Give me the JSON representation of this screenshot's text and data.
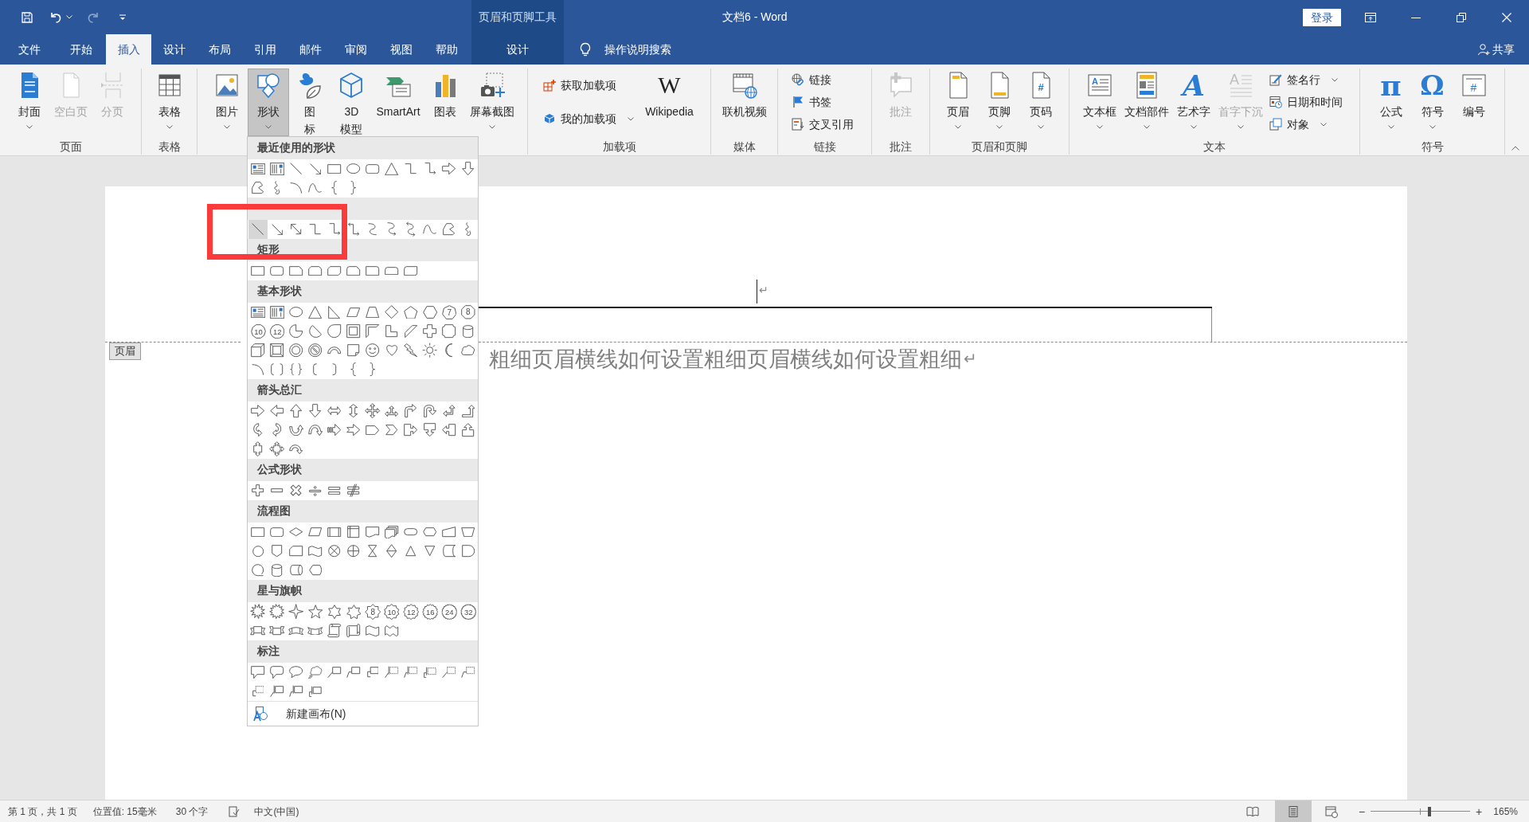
{
  "window": {
    "title": "文档6 - Word",
    "sign_in": "登录",
    "controls": [
      {
        "kind": "ribbon-options"
      },
      {
        "kind": "minimize"
      },
      {
        "kind": "restore"
      },
      {
        "kind": "close"
      }
    ]
  },
  "quick_access": [
    {
      "kind": "save",
      "disabled": false
    },
    {
      "kind": "undo",
      "disabled": false
    },
    {
      "kind": "undo-menu",
      "disabled": false
    },
    {
      "kind": "redo",
      "disabled": true
    },
    {
      "kind": "customize",
      "disabled": false
    }
  ],
  "tabs": [
    {
      "label": "文件",
      "selected": false
    },
    {
      "label": "开始",
      "selected": false
    },
    {
      "label": "插入",
      "selected": true
    },
    {
      "label": "设计",
      "selected": false
    },
    {
      "label": "布局",
      "selected": false
    },
    {
      "label": "引用",
      "selected": false
    },
    {
      "label": "邮件",
      "selected": false
    },
    {
      "label": "审阅",
      "selected": false
    },
    {
      "label": "视图",
      "selected": false
    },
    {
      "label": "帮助",
      "selected": false
    }
  ],
  "context_tabs": {
    "title": "页眉和页脚工具",
    "tabs": [
      {
        "label": "设计",
        "selected": false
      }
    ]
  },
  "tell_me": {
    "label": "操作说明搜索"
  },
  "share": {
    "label": "共享"
  },
  "ribbon": {
    "groups": [
      {
        "label": "页面",
        "items": [
          {
            "kind": "cover",
            "label": "封面",
            "dropdown": true,
            "disabled": false,
            "pressed": false
          },
          {
            "kind": "blank-page",
            "label": "空白页",
            "dropdown": false,
            "disabled": true,
            "pressed": false
          },
          {
            "kind": "page-break",
            "label": "分页",
            "dropdown": false,
            "disabled": true,
            "pressed": false
          }
        ]
      },
      {
        "label": "表格",
        "items": [
          {
            "kind": "table",
            "label": "表格",
            "dropdown": true,
            "disabled": false,
            "pressed": false
          }
        ]
      },
      {
        "items": [
          {
            "kind": "picture",
            "label": "图片",
            "dropdown": true,
            "disabled": false,
            "pressed": false
          },
          {
            "kind": "shapes",
            "label": "形状",
            "dropdown": true,
            "disabled": false,
            "pressed": true
          },
          {
            "kind": "icons",
            "lines": [
              "图",
              "标"
            ],
            "dropdown": false,
            "disabled": false,
            "pressed": false
          },
          {
            "kind": "model3d",
            "lines": [
              "3D",
              "模型"
            ],
            "dropdown": false,
            "disabled": false,
            "pressed": false
          },
          {
            "kind": "smartart",
            "label": "SmartArt",
            "dropdown": false,
            "disabled": false,
            "pressed": false
          },
          {
            "kind": "chart",
            "label": "图表",
            "dropdown": false,
            "disabled": false,
            "pressed": false
          },
          {
            "kind": "screenshot",
            "label": "屏幕截图",
            "dropdown": true,
            "disabled": false,
            "pressed": false
          }
        ]
      },
      {
        "label": "加载项",
        "items": [
          {
            "stack": [
              {
                "kind": "get-addins",
                "label": "获取加载项",
                "dropdown": false,
                "disabled": false
              },
              {
                "kind": "my-addins",
                "label": "我的加载项",
                "dropdown": true,
                "disabled": false
              }
            ]
          },
          {
            "kind": "wikipedia",
            "label": "Wikipedia",
            "glyph": "W",
            "dropdown": false,
            "disabled": false,
            "pressed": false
          }
        ]
      },
      {
        "label": "媒体",
        "items": [
          {
            "kind": "online-video",
            "label": "联机视频",
            "dropdown": false,
            "disabled": false,
            "pressed": false
          }
        ]
      },
      {
        "label": "链接",
        "items": [
          {
            "stack": [
              {
                "kind": "link",
                "label": "链接",
                "dropdown": false,
                "disabled": false
              },
              {
                "kind": "bookmark",
                "label": "书签",
                "dropdown": false,
                "disabled": false
              },
              {
                "kind": "cross-reference",
                "label": "交叉引用",
                "dropdown": false,
                "disabled": false
              }
            ]
          }
        ]
      },
      {
        "label": "批注",
        "items": [
          {
            "kind": "comment",
            "label": "批注",
            "dropdown": false,
            "disabled": true,
            "pressed": false
          }
        ]
      },
      {
        "label": "页眉和页脚",
        "items": [
          {
            "kind": "header",
            "label": "页眉",
            "dropdown": true,
            "disabled": false,
            "pressed": false
          },
          {
            "kind": "footer",
            "label": "页脚",
            "dropdown": true,
            "disabled": false,
            "pressed": false
          },
          {
            "kind": "page-number",
            "label": "页码",
            "glyph": "#",
            "dropdown": true,
            "disabled": false,
            "pressed": false
          }
        ]
      },
      {
        "label": "文本",
        "items": [
          {
            "kind": "textbox",
            "label": "文本框",
            "glyph": "A",
            "dropdown": true,
            "disabled": false,
            "pressed": false
          },
          {
            "kind": "doc-parts",
            "label": "文档部件",
            "dropdown": true,
            "disabled": false,
            "pressed": false
          },
          {
            "kind": "wordart",
            "label": "艺术字",
            "glyph": "A",
            "dropdown": true,
            "disabled": false,
            "pressed": false
          },
          {
            "kind": "drop-cap",
            "label": "首字下沉",
            "glyph": "A",
            "dropdown": true,
            "disabled": true,
            "pressed": false
          },
          {
            "stack": [
              {
                "kind": "signature",
                "label": "签名行",
                "dropdown": true,
                "disabled": false
              },
              {
                "kind": "date-time",
                "label": "日期和时间",
                "dropdown": false,
                "disabled": false
              },
              {
                "kind": "object",
                "label": "对象",
                "dropdown": true,
                "disabled": false
              }
            ]
          }
        ]
      },
      {
        "label": "符号",
        "items": [
          {
            "kind": "equation",
            "label": "公式",
            "glyph": "π",
            "dropdown": true,
            "disabled": false,
            "pressed": false
          },
          {
            "kind": "symbol",
            "label": "符号",
            "glyph": "Ω",
            "dropdown": true,
            "disabled": false,
            "pressed": false
          },
          {
            "kind": "numbering",
            "label": "编号",
            "glyph": "#",
            "dropdown": false,
            "disabled": false,
            "pressed": false
          }
        ]
      }
    ]
  },
  "shapes_menu": {
    "sections": [
      {
        "title": "最近使用的形状",
        "shapes": [
          {
            "kind": "textbox",
            "selected": false
          },
          {
            "kind": "vtextbox",
            "selected": false
          },
          {
            "kind": "line",
            "selected": false
          },
          {
            "kind": "arrow",
            "selected": false
          },
          {
            "kind": "rect",
            "selected": false
          },
          {
            "kind": "oval",
            "selected": false
          },
          {
            "kind": "rrect",
            "selected": false
          },
          {
            "kind": "triangle",
            "selected": false
          },
          {
            "kind": "elbow",
            "selected": false
          },
          {
            "kind": "elbowarrow",
            "selected": false
          },
          {
            "kind": "rightarrow",
            "selected": false
          },
          {
            "kind": "downarrow",
            "selected": false
          },
          {
            "kind": "freeform",
            "selected": false
          },
          {
            "kind": "scribble",
            "selected": false
          },
          {
            "kind": "arc",
            "selected": false
          },
          {
            "kind": "curve",
            "selected": false
          },
          {
            "kind": "lbrace",
            "selected": false
          },
          {
            "kind": "rbrace",
            "selected": false
          }
        ]
      },
      {
        "shapes": [
          {
            "kind": "line",
            "selected": true
          },
          {
            "kind": "arrow",
            "selected": false
          },
          {
            "kind": "darrowline",
            "selected": false
          },
          {
            "kind": "elbow",
            "selected": false
          },
          {
            "kind": "elbowarrow",
            "selected": false
          },
          {
            "kind": "elbowdarrow",
            "selected": false
          },
          {
            "kind": "curvedconn",
            "selected": false
          },
          {
            "kind": "curvedarrow",
            "selected": false
          },
          {
            "kind": "curveddarrow",
            "selected": false
          },
          {
            "kind": "curve",
            "selected": false
          },
          {
            "kind": "freeform",
            "selected": false
          },
          {
            "kind": "scribble",
            "selected": false
          }
        ]
      },
      {
        "title": "矩形",
        "shapes": [
          {
            "kind": "rect",
            "selected": false
          },
          {
            "kind": "rrect",
            "selected": false
          },
          {
            "kind": "snip1",
            "selected": false
          },
          {
            "kind": "snip2same",
            "selected": false
          },
          {
            "kind": "snip2diag",
            "selected": false
          },
          {
            "kind": "snipround",
            "selected": false
          },
          {
            "kind": "round1",
            "selected": false
          },
          {
            "kind": "round2same",
            "selected": false
          },
          {
            "kind": "round2diag",
            "selected": false
          }
        ]
      },
      {
        "title": "基本形状",
        "shapes": [
          {
            "kind": "textbox",
            "selected": false
          },
          {
            "kind": "vtextbox",
            "selected": false
          },
          {
            "kind": "oval",
            "selected": false
          },
          {
            "kind": "triangle",
            "selected": false
          },
          {
            "kind": "rtriangle",
            "selected": false
          },
          {
            "kind": "parallelogram",
            "selected": false
          },
          {
            "kind": "trapezoid",
            "selected": false
          },
          {
            "kind": "diamond",
            "selected": false
          },
          {
            "kind": "pentagon",
            "selected": false
          },
          {
            "kind": "hexagon",
            "selected": false
          },
          {
            "kind": "heptagon",
            "label": "7",
            "selected": false
          },
          {
            "kind": "octagon",
            "label": "8",
            "selected": false
          },
          {
            "kind": "decagon",
            "label": "10",
            "selected": false
          },
          {
            "kind": "dodecagon",
            "label": "12",
            "selected": false
          },
          {
            "kind": "pie",
            "selected": false
          },
          {
            "kind": "chord",
            "selected": false
          },
          {
            "kind": "teardrop",
            "selected": false
          },
          {
            "kind": "frame",
            "selected": false
          },
          {
            "kind": "halfframe",
            "selected": false
          },
          {
            "kind": "lshape",
            "selected": false
          },
          {
            "kind": "diagstripe",
            "selected": false
          },
          {
            "kind": "cross",
            "selected": false
          },
          {
            "kind": "plaque",
            "selected": false
          },
          {
            "kind": "can",
            "selected": false
          },
          {
            "kind": "cube",
            "selected": false
          },
          {
            "kind": "bevel",
            "selected": false
          },
          {
            "kind": "donut",
            "selected": false
          },
          {
            "kind": "nosymbol",
            "selected": false
          },
          {
            "kind": "blockarc",
            "selected": false
          },
          {
            "kind": "folded",
            "selected": false
          },
          {
            "kind": "smiley",
            "selected": false
          },
          {
            "kind": "heart",
            "selected": false
          },
          {
            "kind": "lightning",
            "selected": false
          },
          {
            "kind": "sun",
            "selected": false
          },
          {
            "kind": "moon",
            "selected": false
          },
          {
            "kind": "cloud",
            "selected": false
          },
          {
            "kind": "arc",
            "selected": false
          },
          {
            "kind": "dbracket",
            "selected": false
          },
          {
            "kind": "dbrace",
            "selected": false
          },
          {
            "kind": "lbracket",
            "selected": false
          },
          {
            "kind": "rbracket",
            "selected": false
          },
          {
            "kind": "lbrace",
            "selected": false
          },
          {
            "kind": "rbrace",
            "selected": false
          }
        ]
      },
      {
        "title": "箭头总汇",
        "shapes": [
          {
            "kind": "rightarrow",
            "selected": false
          },
          {
            "kind": "leftarrow",
            "selected": false
          },
          {
            "kind": "uparrow",
            "selected": false
          },
          {
            "kind": "downarrow",
            "selected": false
          },
          {
            "kind": "leftright",
            "selected": false
          },
          {
            "kind": "updown",
            "selected": false
          },
          {
            "kind": "quad",
            "selected": false
          },
          {
            "kind": "leftrightup",
            "selected": false
          },
          {
            "kind": "bent",
            "selected": false
          },
          {
            "kind": "uturn",
            "selected": false
          },
          {
            "kind": "leftup",
            "selected": false
          },
          {
            "kind": "bentup",
            "selected": false
          },
          {
            "kind": "curvedright",
            "selected": false
          },
          {
            "kind": "curvedleft",
            "selected": false
          },
          {
            "kind": "curvedup",
            "selected": false
          },
          {
            "kind": "curveddown",
            "selected": false
          },
          {
            "kind": "striped",
            "selected": false
          },
          {
            "kind": "notched",
            "selected": false
          },
          {
            "kind": "homeplate",
            "selected": false
          },
          {
            "kind": "chevron",
            "selected": false
          },
          {
            "kind": "rightcallout",
            "selected": false
          },
          {
            "kind": "downcallout",
            "selected": false
          },
          {
            "kind": "leftcallout",
            "selected": false
          },
          {
            "kind": "upcallout",
            "selected": false
          },
          {
            "kind": "udcallout",
            "selected": false
          },
          {
            "kind": "quadcallout",
            "selected": false
          },
          {
            "kind": "circular",
            "selected": false
          }
        ]
      },
      {
        "title": "公式形状",
        "shapes": [
          {
            "kind": "plus",
            "selected": false
          },
          {
            "kind": "minus",
            "selected": false
          },
          {
            "kind": "multiply",
            "selected": false
          },
          {
            "kind": "divide",
            "selected": false
          },
          {
            "kind": "equal",
            "selected": false
          },
          {
            "kind": "notequal",
            "selected": false
          }
        ]
      },
      {
        "title": "流程图",
        "shapes": [
          {
            "kind": "rect",
            "selected": false
          },
          {
            "kind": "rrect",
            "selected": false
          },
          {
            "kind": "decision",
            "selected": false
          },
          {
            "kind": "data",
            "selected": false
          },
          {
            "kind": "predefined",
            "selected": false
          },
          {
            "kind": "internal",
            "selected": false
          },
          {
            "kind": "document",
            "selected": false
          },
          {
            "kind": "multidoc",
            "selected": false
          },
          {
            "kind": "terminator",
            "selected": false
          },
          {
            "kind": "preparation",
            "selected": false
          },
          {
            "kind": "manualinput",
            "selected": false
          },
          {
            "kind": "manualop",
            "selected": false
          },
          {
            "kind": "connector",
            "selected": false
          },
          {
            "kind": "offpage",
            "selected": false
          },
          {
            "kind": "card",
            "selected": false
          },
          {
            "kind": "wave",
            "selected": false
          },
          {
            "kind": "summing",
            "selected": false
          },
          {
            "kind": "orjunction",
            "selected": false
          },
          {
            "kind": "collate",
            "selected": false
          },
          {
            "kind": "sort",
            "selected": false
          },
          {
            "kind": "extract",
            "selected": false
          },
          {
            "kind": "merge",
            "selected": false
          },
          {
            "kind": "storeddata",
            "selected": false
          },
          {
            "kind": "delay",
            "selected": false
          },
          {
            "kind": "seqaccess",
            "selected": false
          },
          {
            "kind": "can",
            "selected": false
          },
          {
            "kind": "directaccess",
            "selected": false
          },
          {
            "kind": "display",
            "selected": false
          }
        ]
      },
      {
        "title": "星与旗帜",
        "shapes": [
          {
            "kind": "explosion1",
            "selected": false
          },
          {
            "kind": "explosion2",
            "selected": false
          },
          {
            "kind": "star4",
            "selected": false
          },
          {
            "kind": "star5",
            "selected": false
          },
          {
            "kind": "star6",
            "selected": false
          },
          {
            "kind": "star7",
            "selected": false
          },
          {
            "kind": "star8",
            "label": "8",
            "selected": false
          },
          {
            "kind": "star10",
            "label": "10",
            "selected": false
          },
          {
            "kind": "star12",
            "label": "12",
            "selected": false
          },
          {
            "kind": "star16",
            "label": "16",
            "selected": false
          },
          {
            "kind": "star24",
            "label": "24",
            "selected": false
          },
          {
            "kind": "star32",
            "label": "32",
            "selected": false
          },
          {
            "kind": "ribbondown",
            "selected": false
          },
          {
            "kind": "ribbonup",
            "selected": false
          },
          {
            "kind": "curvedribbondown",
            "selected": false
          },
          {
            "kind": "curvedribbonup",
            "selected": false
          },
          {
            "kind": "vscroll",
            "selected": false
          },
          {
            "kind": "hscroll",
            "selected": false
          },
          {
            "kind": "wave",
            "selected": false
          },
          {
            "kind": "doublewave",
            "selected": false
          }
        ]
      },
      {
        "title": "标注",
        "shapes": [
          {
            "kind": "calloutrect",
            "selected": false
          },
          {
            "kind": "calloutrrect",
            "selected": false
          },
          {
            "kind": "calloutoval",
            "selected": false
          },
          {
            "kind": "calloutcloud",
            "selected": false
          },
          {
            "kind": "lc1",
            "selected": false
          },
          {
            "kind": "lc2",
            "selected": false
          },
          {
            "kind": "lc3",
            "selected": false
          },
          {
            "kind": "ac1",
            "selected": false
          },
          {
            "kind": "ac2",
            "selected": false
          },
          {
            "kind": "ac3",
            "selected": false
          },
          {
            "kind": "nb1",
            "selected": false
          },
          {
            "kind": "nb2",
            "selected": false
          },
          {
            "kind": "nb3",
            "selected": false
          },
          {
            "kind": "ab1",
            "selected": false
          },
          {
            "kind": "ab2",
            "selected": false
          },
          {
            "kind": "ab3",
            "selected": false
          }
        ]
      }
    ],
    "new_canvas": "新建画布(N)"
  },
  "document": {
    "header_tag": "页眉",
    "header_paragraph_mark": "↵",
    "body": {
      "text": "粗细页眉横线如何设置粗细页眉横线如何设置粗细",
      "paragraph_mark": "↵"
    }
  },
  "annotations": [
    {
      "kind": "frame"
    }
  ],
  "status_bar": {
    "page": "第 1 页，共 1 页",
    "position": "位置值: 15毫米",
    "word_count": "30 个字",
    "language": "中文(中国)",
    "views": [
      {
        "kind": "read",
        "selected": false
      },
      {
        "kind": "print",
        "selected": true
      },
      {
        "kind": "web",
        "selected": false
      }
    ],
    "zoom": {
      "minus": "−",
      "plus": "+",
      "level": 0.59,
      "percent": "165%"
    }
  }
}
